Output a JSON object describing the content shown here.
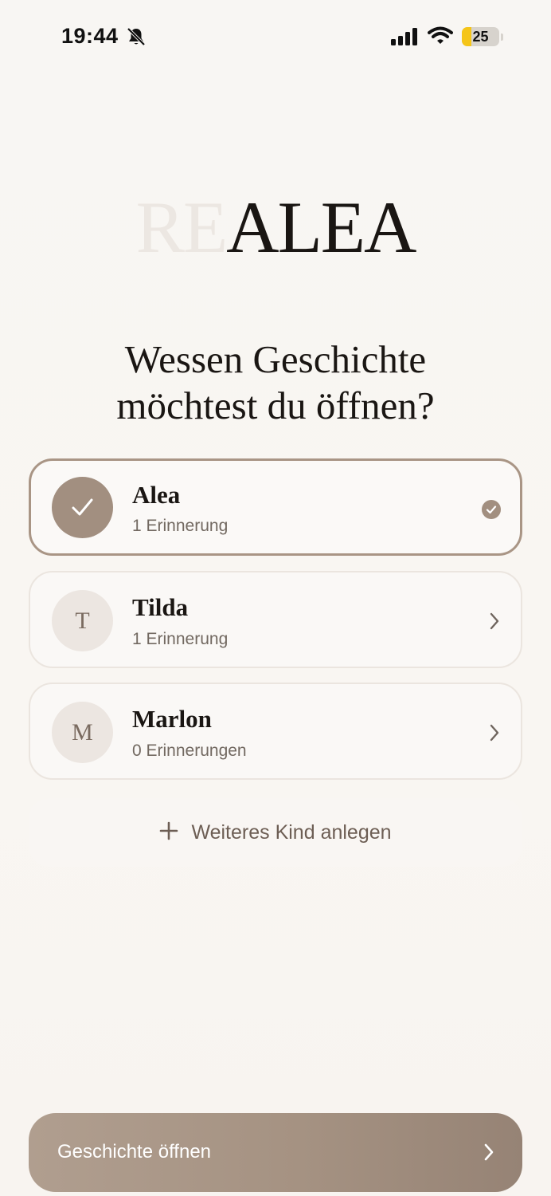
{
  "status_bar": {
    "time": "19:44",
    "battery_percent": 25,
    "battery_label": "25",
    "icons": [
      "bell-slash-icon",
      "cellular-signal-icon",
      "wifi-icon",
      "battery-icon"
    ]
  },
  "logo": {
    "prefix": "RE",
    "main": "ALEA"
  },
  "heading": {
    "line1": "Wessen Geschichte",
    "line2": "möchtest du öffnen?"
  },
  "children": [
    {
      "initial": "",
      "name": "Alea",
      "memories": "1 Erinnerung",
      "selected": true
    },
    {
      "initial": "T",
      "name": "Tilda",
      "memories": "1 Erinnerung",
      "selected": false
    },
    {
      "initial": "M",
      "name": "Marlon",
      "memories": "0 Erinnerungen",
      "selected": false
    }
  ],
  "add_child": {
    "label": "Weiteres Kind anlegen",
    "icon": "plus-icon"
  },
  "primary_button": {
    "label": "Geschichte öffnen",
    "icon": "chevron-right-icon"
  },
  "colors": {
    "background": "#f8f6f3",
    "accent": "#a28f80",
    "text": "#1a1613",
    "muted_text": "#726961",
    "battery_fill": "#f5c518"
  }
}
